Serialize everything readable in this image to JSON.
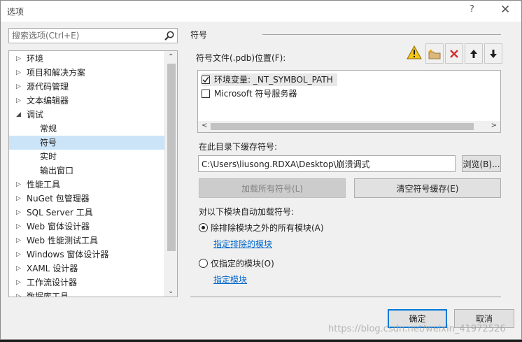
{
  "window": {
    "title": "选项",
    "help_glyph": "?",
    "close_glyph": "✕"
  },
  "search": {
    "placeholder": "搜索选项(Ctrl+E)"
  },
  "tree": {
    "items": [
      {
        "label": "环境",
        "arrow": "▷"
      },
      {
        "label": "项目和解决方案",
        "arrow": "▷"
      },
      {
        "label": "源代码管理",
        "arrow": "▷"
      },
      {
        "label": "文本编辑器",
        "arrow": "▷"
      },
      {
        "label": "调试",
        "arrow": "◢"
      },
      {
        "label": "常规",
        "arrow": ""
      },
      {
        "label": "符号",
        "arrow": ""
      },
      {
        "label": "实时",
        "arrow": ""
      },
      {
        "label": "输出窗口",
        "arrow": ""
      },
      {
        "label": "性能工具",
        "arrow": "▷"
      },
      {
        "label": "NuGet 包管理器",
        "arrow": "▷"
      },
      {
        "label": "SQL Server 工具",
        "arrow": "▷"
      },
      {
        "label": "Web 窗体设计器",
        "arrow": "▷"
      },
      {
        "label": "Web 性能测试工具",
        "arrow": "▷"
      },
      {
        "label": "Windows 窗体设计器",
        "arrow": "▷"
      },
      {
        "label": "XAML 设计器",
        "arrow": "▷"
      },
      {
        "label": "工作流设计器",
        "arrow": "▷"
      },
      {
        "label": "数据库工具",
        "arrow": "▷"
      }
    ],
    "scroll_up": "⌃",
    "scroll_down": "⌄"
  },
  "symbols": {
    "section_title": "符号",
    "paths_label": "符号文件(.pdb)位置(F):",
    "locations": [
      {
        "label": "环境变量: _NT_SYMBOL_PATH",
        "checked": true
      },
      {
        "label": "Microsoft 符号服务器",
        "checked": false
      }
    ],
    "hscroll_left": "<",
    "hscroll_right": ">",
    "cache_label": "在此目录下缓存符号:",
    "cache_path": "C:\\Users\\liusong.RDXA\\Desktop\\崩溃调式",
    "browse_label": "浏览(B)...",
    "load_all_label": "加载所有符号(L)",
    "clear_cache_label": "清空符号缓存(E)",
    "autoload_label": "对以下模块自动加载符号:",
    "option_all_label": "除排除模块之外的所有模块(A)",
    "exclude_link": "指定排除的模块",
    "option_only_label": "仅指定的模块(O)",
    "include_link": "指定模块"
  },
  "footer": {
    "ok_label": "确定",
    "cancel_label": "取消",
    "watermark": "https://blog.csdn.net/weixin_41972526"
  },
  "colors": {
    "accent": "#0078d7",
    "selection": "#cce4f7",
    "link": "#0066cc",
    "delete_red": "#d32f2f",
    "warning_yellow": "#f5c518"
  }
}
